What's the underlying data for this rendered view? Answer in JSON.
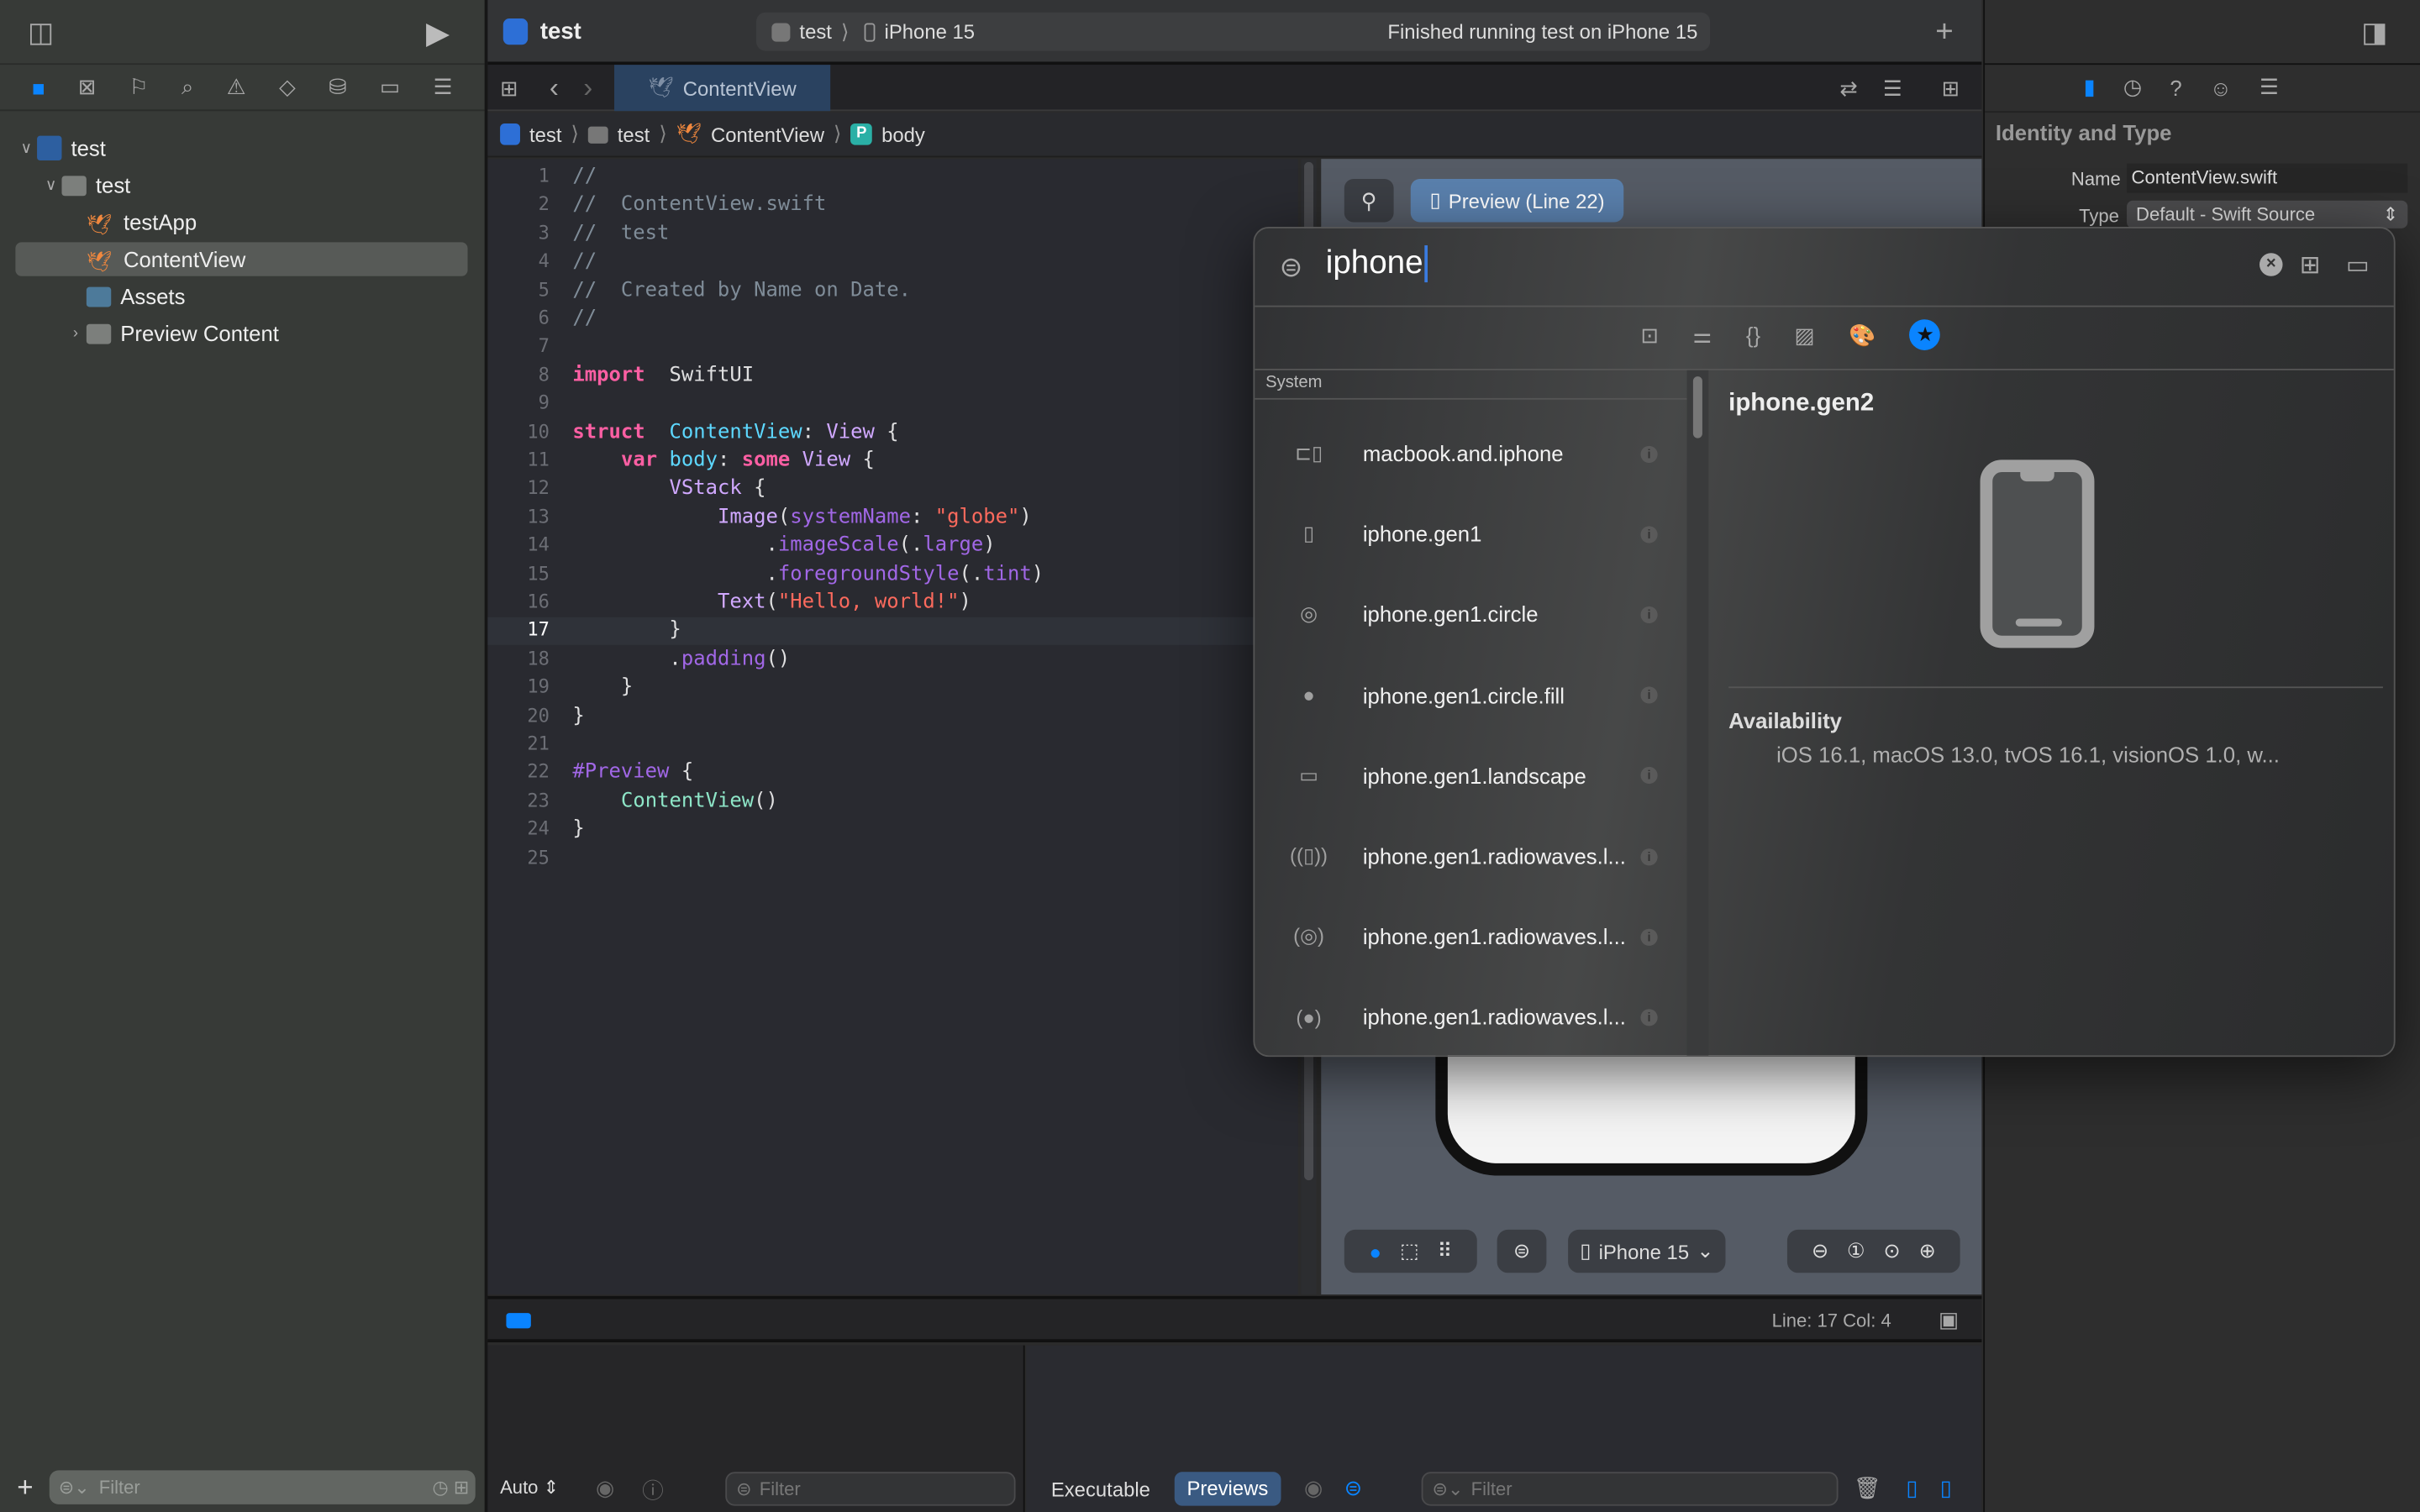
{
  "toolbar": {
    "project": "test",
    "scheme": "test",
    "device": "iPhone 15",
    "status": "Finished running test on iPhone 15"
  },
  "navigator": {
    "tree": [
      {
        "label": "test",
        "level": 0,
        "expanded": true
      },
      {
        "label": "test",
        "level": 1,
        "expanded": true
      },
      {
        "label": "testApp",
        "level": 2
      },
      {
        "label": "ContentView",
        "level": 2,
        "selected": true
      },
      {
        "label": "Assets",
        "level": 2
      },
      {
        "label": "Preview Content",
        "level": 2,
        "expanded": false
      }
    ],
    "filter_placeholder": "Filter"
  },
  "editor": {
    "tab": "ContentView",
    "breadcrumb": [
      "test",
      "test",
      "ContentView",
      "body"
    ],
    "current_line": 17,
    "lines": [
      [
        [
          "cm",
          "//"
        ]
      ],
      [
        [
          "cm",
          "//  ContentView.swift"
        ]
      ],
      [
        [
          "cm",
          "//  test"
        ]
      ],
      [
        [
          "cm",
          "//"
        ]
      ],
      [
        [
          "cm",
          "//  Created by Name on Date."
        ]
      ],
      [
        [
          "cm",
          "//"
        ]
      ],
      [],
      [
        [
          "kw",
          "import"
        ],
        [
          "",
          "  SwiftUI"
        ]
      ],
      [],
      [
        [
          "kw",
          "struct"
        ],
        [
          "",
          "  "
        ],
        [
          "ty",
          "ContentView"
        ],
        [
          "",
          ": "
        ],
        [
          "tp",
          "View"
        ],
        [
          "",
          " {"
        ]
      ],
      [
        [
          "",
          "    "
        ],
        [
          "kw",
          "var"
        ],
        [
          "",
          " "
        ],
        [
          "ty",
          "body"
        ],
        [
          "",
          ": "
        ],
        [
          "kw",
          "some"
        ],
        [
          "",
          " "
        ],
        [
          "tp",
          "View"
        ],
        [
          "",
          " {"
        ]
      ],
      [
        [
          "",
          "        "
        ],
        [
          "tp",
          "VStack"
        ],
        [
          "",
          " {"
        ]
      ],
      [
        [
          "",
          "            "
        ],
        [
          "tp",
          "Image"
        ],
        [
          "",
          "("
        ],
        [
          "fn",
          "systemName"
        ],
        [
          "",
          ": "
        ],
        [
          "st",
          "\"globe\""
        ],
        [
          "",
          ")"
        ]
      ],
      [
        [
          "",
          "                ."
        ],
        [
          "fn",
          "imageScale"
        ],
        [
          "",
          "(."
        ],
        [
          "fn",
          "large"
        ],
        [
          "",
          ")"
        ]
      ],
      [
        [
          "",
          "                ."
        ],
        [
          "fn",
          "foregroundStyle"
        ],
        [
          "",
          "(."
        ],
        [
          "fn",
          "tint"
        ],
        [
          "",
          ")"
        ]
      ],
      [
        [
          "",
          "            "
        ],
        [
          "tp",
          "Text"
        ],
        [
          "",
          "("
        ],
        [
          "st",
          "\"Hello, world!\""
        ],
        [
          "",
          ")"
        ]
      ],
      [
        [
          "",
          "        }"
        ]
      ],
      [
        [
          "",
          "        ."
        ],
        [
          "fn",
          "padding"
        ],
        [
          "",
          "()"
        ]
      ],
      [
        [
          "",
          "    }"
        ]
      ],
      [
        [
          "",
          "}"
        ]
      ],
      [],
      [
        [
          "fn",
          "#Preview"
        ],
        [
          "",
          " {"
        ]
      ],
      [
        [
          "",
          "    "
        ],
        [
          "ct",
          "ContentView"
        ],
        [
          "",
          "()"
        ]
      ],
      [
        [
          "",
          "}"
        ]
      ],
      []
    ]
  },
  "canvas": {
    "preview_label": "Preview (Line 22)",
    "device": "iPhone 15"
  },
  "statusbar": {
    "position": "Line: 17  Col: 4"
  },
  "debug": {
    "mode": "Auto",
    "filter_placeholder": "Filter",
    "tabs": [
      "Executable",
      "Previews"
    ],
    "active_tab": "Previews"
  },
  "inspector": {
    "section": "Identity and Type",
    "name_label": "Name",
    "name_value": "ContentView.swift",
    "type_label": "Type",
    "type_value": "Default - Swift Source"
  },
  "library": {
    "search": "iphone",
    "section": "System",
    "items": [
      "macbook.and.iphone",
      "iphone.gen1",
      "iphone.gen1.circle",
      "iphone.gen1.circle.fill",
      "iphone.gen1.landscape",
      "iphone.gen1.radiowaves.l...",
      "iphone.gen1.radiowaves.l...",
      "iphone.gen1.radiowaves.l..."
    ],
    "detail": {
      "title": "iphone.gen2",
      "availability_label": "Availability",
      "availability": "iOS 16.1, macOS 13.0, tvOS 16.1, visionOS 1.0, w..."
    },
    "accent": "#0a84ff"
  }
}
